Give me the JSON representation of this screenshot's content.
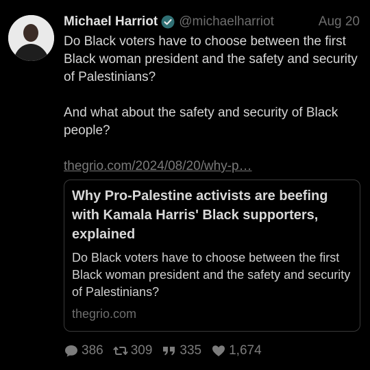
{
  "tweet": {
    "author_name": "Michael Harriot",
    "handle": "@michaelharriot",
    "date": "Aug 20",
    "paragraphs": [
      "Do Black voters have to choose between the first Black woman president and the safety and security of Palestinians?",
      "And what about the safety and security of Black people?"
    ],
    "link": "thegrio.com/2024/08/20/why-p…"
  },
  "card": {
    "title": "Why Pro-Palestine activists are beefing with Kamala Harris' Black supporters, explained",
    "description": "Do Black voters have to choose between the first Black woman president and the safety and security of Palestinians?",
    "domain": "thegrio.com"
  },
  "stats": {
    "replies": "386",
    "reblogs": "309",
    "quotes": "335",
    "likes": "1,674"
  },
  "icons": {
    "verified": "verified-badge-icon",
    "reply": "speech-bubble-icon",
    "reblog": "retweet-icon",
    "quote": "quote-marks-icon",
    "like": "heart-icon"
  },
  "colors": {
    "background": "#000000",
    "text": "#d6d6d6",
    "muted": "#6e6e6e",
    "verified": "#2f6f73"
  }
}
